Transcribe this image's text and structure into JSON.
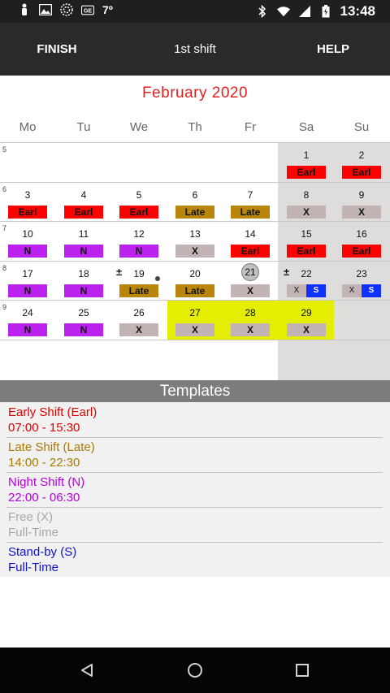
{
  "status_bar": {
    "temperature": "7º",
    "time": "13:48",
    "icons": [
      "person-icon",
      "image-icon",
      "radar-icon",
      "ge-icon",
      "bluetooth-icon",
      "wifi-icon",
      "signal-icon",
      "battery-icon"
    ]
  },
  "toolbar": {
    "finish_label": "FINISH",
    "shift_label": "1st shift",
    "help_label": "HELP"
  },
  "calendar": {
    "month_title": "February  2020",
    "day_headers": [
      "Mo",
      "Tu",
      "We",
      "Th",
      "Fr",
      "Sa",
      "Su"
    ],
    "week_numbers": [
      "5",
      "6",
      "7",
      "8",
      "9"
    ],
    "selected_day": "21",
    "highlighted_days": [
      "27",
      "28",
      "29"
    ],
    "weeks": [
      [
        null,
        null,
        null,
        null,
        null,
        {
          "day": "1",
          "shift": "Earl",
          "type": "earl"
        },
        {
          "day": "2",
          "shift": "Earl",
          "type": "earl"
        }
      ],
      [
        {
          "day": "3",
          "shift": "Earl",
          "type": "earl"
        },
        {
          "day": "4",
          "shift": "Earl",
          "type": "earl"
        },
        {
          "day": "5",
          "shift": "Earl",
          "type": "earl"
        },
        {
          "day": "6",
          "shift": "Late",
          "type": "late"
        },
        {
          "day": "7",
          "shift": "Late",
          "type": "late"
        },
        {
          "day": "8",
          "shift": "X",
          "type": "free"
        },
        {
          "day": "9",
          "shift": "X",
          "type": "free"
        }
      ],
      [
        {
          "day": "10",
          "shift": "N",
          "type": "night"
        },
        {
          "day": "11",
          "shift": "N",
          "type": "night"
        },
        {
          "day": "12",
          "shift": "N",
          "type": "night"
        },
        {
          "day": "13",
          "shift": "X",
          "type": "free"
        },
        {
          "day": "14",
          "shift": "Earl",
          "type": "earl"
        },
        {
          "day": "15",
          "shift": "Earl",
          "type": "earl"
        },
        {
          "day": "16",
          "shift": "Earl",
          "type": "earl"
        }
      ],
      [
        {
          "day": "17",
          "shift": "N",
          "type": "night"
        },
        {
          "day": "18",
          "shift": "N",
          "type": "night"
        },
        {
          "day": "19",
          "shift": "Late",
          "type": "late",
          "mark": "±",
          "dot": true
        },
        {
          "day": "20",
          "shift": "Late",
          "type": "late"
        },
        {
          "day": "21",
          "shift": "X",
          "type": "free",
          "circled": true
        },
        {
          "day": "22",
          "shift": "X",
          "shift2": "S",
          "type": "split",
          "mark": "±"
        },
        {
          "day": "23",
          "shift": "X",
          "shift2": "S",
          "type": "split"
        }
      ],
      [
        {
          "day": "24",
          "shift": "N",
          "type": "night"
        },
        {
          "day": "25",
          "shift": "N",
          "type": "night"
        },
        {
          "day": "26",
          "shift": "X",
          "type": "free"
        },
        {
          "day": "27",
          "shift": "X",
          "type": "free"
        },
        {
          "day": "28",
          "shift": "X",
          "type": "free"
        },
        {
          "day": "29",
          "shift": "X",
          "type": "free"
        },
        null
      ]
    ]
  },
  "templates": {
    "header": "Templates",
    "items": [
      {
        "name": "Early Shift (Earl)",
        "detail": "07:00 - 15:30",
        "color": "#e00000"
      },
      {
        "name": "Late Shift (Late)",
        "detail": "14:00 - 22:30",
        "color": "#a87a00"
      },
      {
        "name": "Night Shift (N)",
        "detail": "22:00 - 06:30",
        "color": "#b400e0"
      },
      {
        "name": "Free (X)",
        "detail": "Full-Time",
        "color": "#a8a8a8"
      },
      {
        "name": "Stand-by (S)",
        "detail": "Full-Time",
        "color": "#1010d8"
      }
    ]
  },
  "colors": {
    "earl": "#ff0000",
    "late": "#b8860b",
    "night": "#bb22ee",
    "free": "#c2b4b4",
    "standby": "#1030ff",
    "highlight": "#e3ee00",
    "month_title": "#e32020"
  },
  "nav_bar": {
    "icons": [
      "back-icon",
      "home-icon",
      "recents-icon"
    ]
  }
}
